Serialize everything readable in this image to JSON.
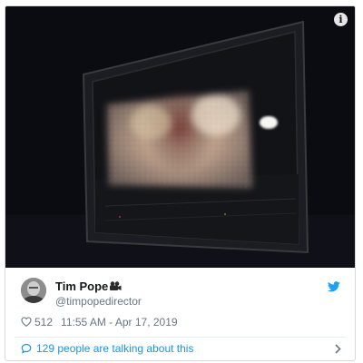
{
  "tweet": {
    "author": {
      "name": "Tim Pope",
      "handle": "@timpopedirector",
      "name_emoji": "movie-camera-icon",
      "avatar": "avatar-photo"
    },
    "media": {
      "description_icon": "info-icon",
      "info_glyph": "i"
    },
    "stats": {
      "likes": "512",
      "timestamp": "11:55 AM - Apr 17, 2019"
    },
    "conversation": {
      "text": "129 people are talking about this",
      "icon": "speech-bubble-icon"
    },
    "colors": {
      "link": "#1b95e0",
      "muted": "#657786",
      "twitter_blue": "#1da1f2"
    }
  }
}
